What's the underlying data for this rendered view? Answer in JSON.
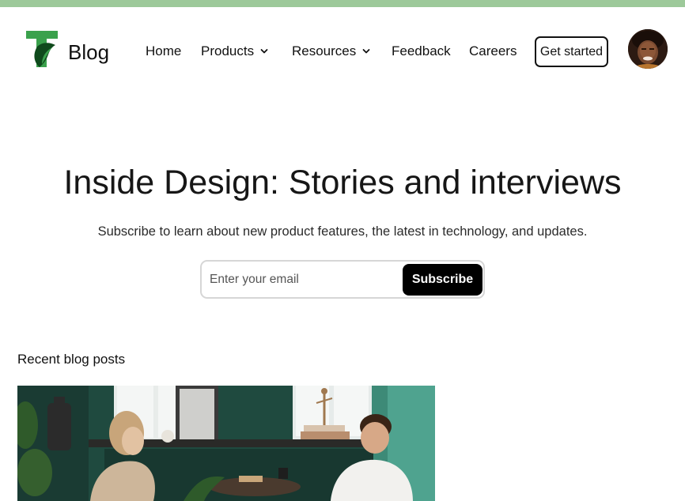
{
  "header": {
    "brand": "Blog",
    "nav": [
      {
        "label": "Home",
        "has_dropdown": false
      },
      {
        "label": "Products",
        "has_dropdown": true
      },
      {
        "label": "Resources",
        "has_dropdown": true
      },
      {
        "label": "Feedback",
        "has_dropdown": false
      },
      {
        "label": "Careers",
        "has_dropdown": false
      }
    ],
    "cta_label": "Get started"
  },
  "hero": {
    "title": "Inside Design: Stories and interviews",
    "subtitle": "Subscribe to learn about new product features, the latest in technology, and updates.",
    "email_placeholder": "Enter your email",
    "subscribe_label": "Subscribe"
  },
  "posts": {
    "section_title": "Recent blog posts"
  },
  "colors": {
    "top_strip": "#9dc99a",
    "logo_green": "#3aa14c",
    "button_dark": "#000000"
  },
  "icons": [
    "logo-icon",
    "chevron-down-icon",
    "user-avatar"
  ]
}
